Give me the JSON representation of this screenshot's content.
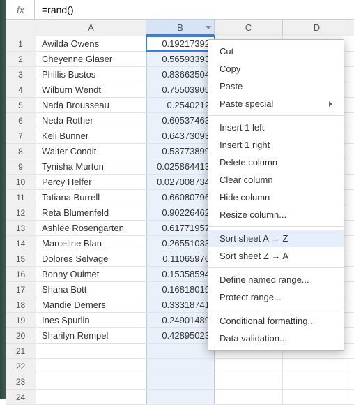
{
  "formula_bar": {
    "fx_label": "fx",
    "value": "=rand()"
  },
  "columns": [
    "A",
    "B",
    "C",
    "D"
  ],
  "selected_column": "B",
  "rows": [
    {
      "n": 1,
      "a": "Awilda Owens",
      "b": "0.19217392"
    },
    {
      "n": 2,
      "a": "Cheyenne Glaser",
      "b": "0.56593393"
    },
    {
      "n": 3,
      "a": "Phillis Bustos",
      "b": "0.83663504"
    },
    {
      "n": 4,
      "a": "Wilburn Wendt",
      "b": "0.75503905"
    },
    {
      "n": 5,
      "a": "Nada Brousseau",
      "b": "0.2540212"
    },
    {
      "n": 6,
      "a": "Neda Rother",
      "b": "0.60537463"
    },
    {
      "n": 7,
      "a": "Keli Bunner",
      "b": "0.64373093"
    },
    {
      "n": 8,
      "a": "Walter Condit",
      "b": "0.53773899"
    },
    {
      "n": 9,
      "a": "Tynisha Murton",
      "b": "0.025864413"
    },
    {
      "n": 10,
      "a": "Percy Helfer",
      "b": "0.027008734"
    },
    {
      "n": 11,
      "a": "Tatiana Burrell",
      "b": "0.66080796"
    },
    {
      "n": 12,
      "a": "Reta Blumenfeld",
      "b": "0.90226462"
    },
    {
      "n": 13,
      "a": "Ashlee Rosengarten",
      "b": "0.61771957"
    },
    {
      "n": 14,
      "a": "Marceline Blan",
      "b": "0.26551033"
    },
    {
      "n": 15,
      "a": "Dolores Selvage",
      "b": "0.11065976"
    },
    {
      "n": 16,
      "a": "Bonny Ouimet",
      "b": "0.15358594"
    },
    {
      "n": 17,
      "a": "Shana Bott",
      "b": "0.16818019"
    },
    {
      "n": 18,
      "a": "Mandie Demers",
      "b": "0.33318741"
    },
    {
      "n": 19,
      "a": "Ines Spurlin",
      "b": "0.24901489"
    },
    {
      "n": 20,
      "a": "Sharilyn Rempel",
      "b": "0.42895023"
    },
    {
      "n": 21,
      "a": "",
      "b": ""
    },
    {
      "n": 22,
      "a": "",
      "b": ""
    },
    {
      "n": 23,
      "a": "",
      "b": ""
    },
    {
      "n": 24,
      "a": "",
      "b": ""
    }
  ],
  "context_menu": {
    "cut": "Cut",
    "copy": "Copy",
    "paste": "Paste",
    "paste_special": "Paste special",
    "insert_left": "Insert 1 left",
    "insert_right": "Insert 1 right",
    "delete_column": "Delete column",
    "clear_column": "Clear column",
    "hide_column": "Hide column",
    "resize_column": "Resize column...",
    "sort_az": "Sort sheet A → Z",
    "sort_za": "Sort sheet Z → A",
    "named_range": "Define named range...",
    "protect_range": "Protect range...",
    "cond_format": "Conditional formatting...",
    "data_validation": "Data validation..."
  }
}
